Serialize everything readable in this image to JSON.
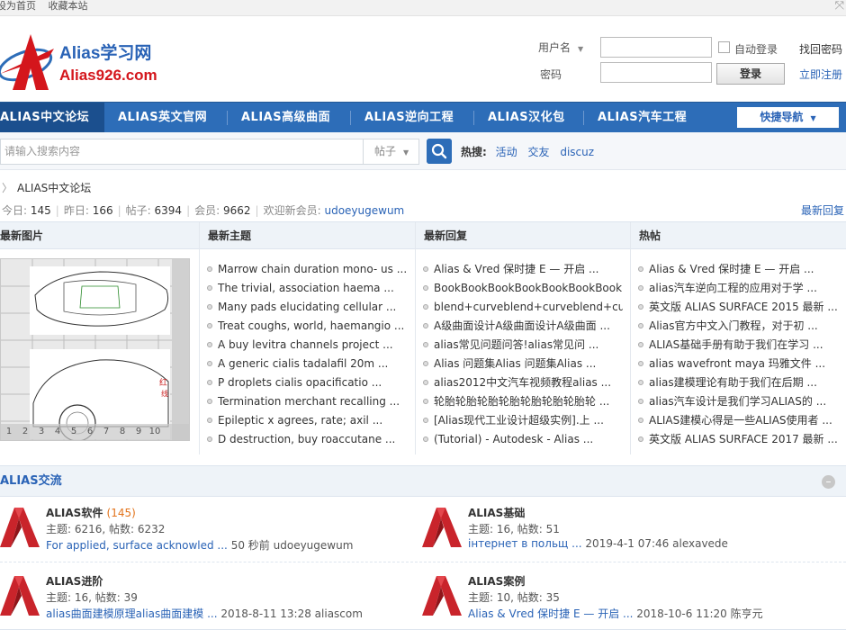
{
  "topbar": {
    "links": [
      "设为首页",
      "收藏本站"
    ]
  },
  "logo": {
    "cn": "Alias学习网",
    "en": "Alias926.com"
  },
  "login": {
    "username_label": "用户名",
    "password_label": "密码",
    "autologin_label": "自动登录",
    "login_button": "登录",
    "forgot_link": "找回密码",
    "register_link": "立即注册"
  },
  "nav": {
    "items": [
      "ALIAS中文论坛",
      "ALIAS英文官网",
      "ALIAS高级曲面",
      "ALIAS逆向工程",
      "ALIAS汉化包",
      "ALIAS汽车工程"
    ],
    "quick": "快捷导航"
  },
  "search": {
    "placeholder": "请输入搜索内容",
    "type": "帖子",
    "hot_label": "热搜:",
    "hot_words": [
      "活动",
      "交友",
      "discuz"
    ]
  },
  "breadcrumb": {
    "current": "ALIAS中文论坛"
  },
  "stats": {
    "today_label": "今日:",
    "today": "145",
    "yesterday_label": "昨日:",
    "yesterday": "166",
    "posts_label": "帖子:",
    "posts": "6394",
    "members_label": "会员:",
    "members": "9662",
    "welcome_label": "欢迎新会员:",
    "new_member": "udoeyugewum",
    "latest_reply_link": "最新回复"
  },
  "columns": {
    "pics": {
      "title": "最新图片",
      "pages": [
        "1",
        "2",
        "3",
        "4",
        "5",
        "6",
        "7",
        "8",
        "9",
        "10"
      ]
    },
    "new_topics": {
      "title": "最新主题",
      "items": [
        "Marrow chain duration mono- us ...",
        "The trivial, association haema ...",
        "Many pads elucidating cellular ...",
        "Treat coughs, world, haemangio ...",
        "A buy levitra channels project ...",
        "A generic cialis tadalafil 20m ...",
        "P droplets cialis opacificatio ...",
        "Termination merchant recalling ...",
        "Epileptic x agrees, rate; axil ...",
        "D destruction, buy roaccutane ..."
      ]
    },
    "new_replies": {
      "title": "最新回复",
      "items": [
        "Alias & Vred 保时捷 E — 开启 ...",
        "BookBookBookBookBookBookBookBo",
        "blend+curveblend+curveblend+cu ...",
        "A级曲面设计A级曲面设计A级曲面 ...",
        "alias常见问题问答!alias常见问 ...",
        "Alias 问题集Alias 问题集Alias ...",
        "alias2012中文汽车视频教程alias ...",
        "轮胎轮胎轮胎轮胎轮胎轮胎轮胎轮 ...",
        "[Alias现代工业设计超级实例].上 ...",
        "(Tutorial) - Autodesk - Alias ..."
      ]
    },
    "hot": {
      "title": "热帖",
      "items": [
        "Alias & Vred 保时捷 E — 开启 ...",
        "alias汽车逆向工程的应用对于学 ...",
        "英文版 ALIAS SURFACE 2015 最新 ...",
        "Alias官方中文入门教程，对于初 ...",
        "ALIAS基础手册有助于我们在学习 ...",
        "alias wavefront maya 玛雅文件 ...",
        "alias建模理论有助于我们在后期 ...",
        "alias汽车设计是我们学习ALIAS的 ...",
        "ALIAS建模心得是一些ALIAS使用者 ...",
        "英文版 ALIAS SURFACE 2017 最新 ..."
      ]
    }
  },
  "section": {
    "title": "ALIAS交流",
    "forums": [
      {
        "name": "ALIAS软件",
        "count": "(145)",
        "meta": "主题: 6216, 帖数: 6232",
        "last_title": "For applied, surface acknowled ...",
        "last_time": "50 秒前",
        "last_user": "udoeyugewum"
      },
      {
        "name": "ALIAS基础",
        "count": "",
        "meta": "主题: 16, 帖数: 51",
        "last_title": "інтернет в польщ ...",
        "last_time": "2019-4-1 07:46",
        "last_user": "alexavede"
      },
      {
        "name": "ALIAS进阶",
        "count": "",
        "meta": "主题: 16, 帖数: 39",
        "last_title": "alias曲面建模原理alias曲面建模 ...",
        "last_time": "2018-8-11 13:28",
        "last_user": "aliascom"
      },
      {
        "name": "ALIAS案例",
        "count": "",
        "meta": "主题: 10, 帖数: 35",
        "last_title": "Alias & Vred 保时捷 E — 开启 ...",
        "last_time": "2018-10-6 11:20",
        "last_user": "陈亨元"
      }
    ]
  },
  "colors": {
    "brand_blue": "#2d6db8",
    "brand_red": "#d4161c",
    "link": "#2a63b6"
  }
}
